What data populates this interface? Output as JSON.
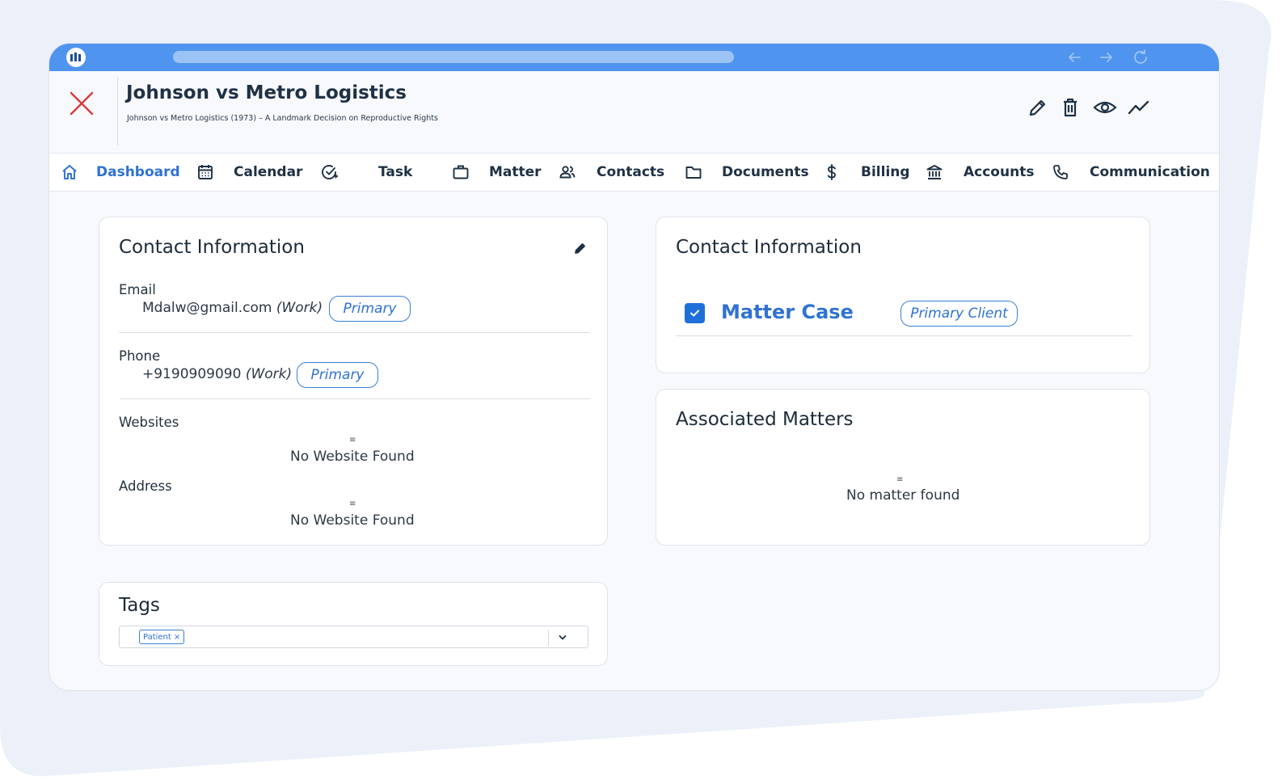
{
  "colors": {
    "accent": "#2f72d2",
    "titlebar": "#4f94ee",
    "close": "#d93a3a",
    "checkbox": "#1e6fd9"
  },
  "header": {
    "title": "Johnson vs Metro Logistics",
    "subtitle": "Johnson vs Metro Logistics (1973) – A Landmark Decision on Reproductive Rights",
    "icons": [
      "pencil-icon",
      "trash-icon",
      "eye-icon",
      "activity-icon"
    ]
  },
  "tabs": [
    {
      "label": "Dashboard",
      "icon": "home-icon",
      "active": true
    },
    {
      "label": "Calendar",
      "icon": "calendar-icon"
    },
    {
      "label": "Task",
      "icon": "task-check-icon"
    },
    {
      "label": "Matter",
      "icon": "briefcase-icon"
    },
    {
      "label": "Contacts",
      "icon": "people-icon"
    },
    {
      "label": "Documents",
      "icon": "folder-icon"
    },
    {
      "label": "Billing",
      "icon": "dollar-icon"
    },
    {
      "label": "Accounts",
      "icon": "bank-icon"
    },
    {
      "label": "Communication",
      "icon": "phone-icon"
    }
  ],
  "contact_card": {
    "title": "Contact Information",
    "email": {
      "label": "Email",
      "value": "Mdalw@gmail.com",
      "type": "(Work)",
      "badge": "Primary"
    },
    "phone": {
      "label": "Phone",
      "value": "+9190909090",
      "type": "(Work)",
      "badge": "Primary"
    },
    "websites": {
      "label": "Websites",
      "empty": "No Website Found"
    },
    "address": {
      "label": "Address",
      "empty": "No Website Found"
    }
  },
  "matter_card": {
    "title": "Contact Information",
    "matter_name": "Matter Case",
    "checked": true,
    "badge": "Primary Client"
  },
  "associated": {
    "title": "Associated Matters",
    "empty": "No matter found"
  },
  "tags": {
    "title": "Tags",
    "chips": [
      {
        "label": "Patient",
        "remove": "×"
      }
    ]
  }
}
